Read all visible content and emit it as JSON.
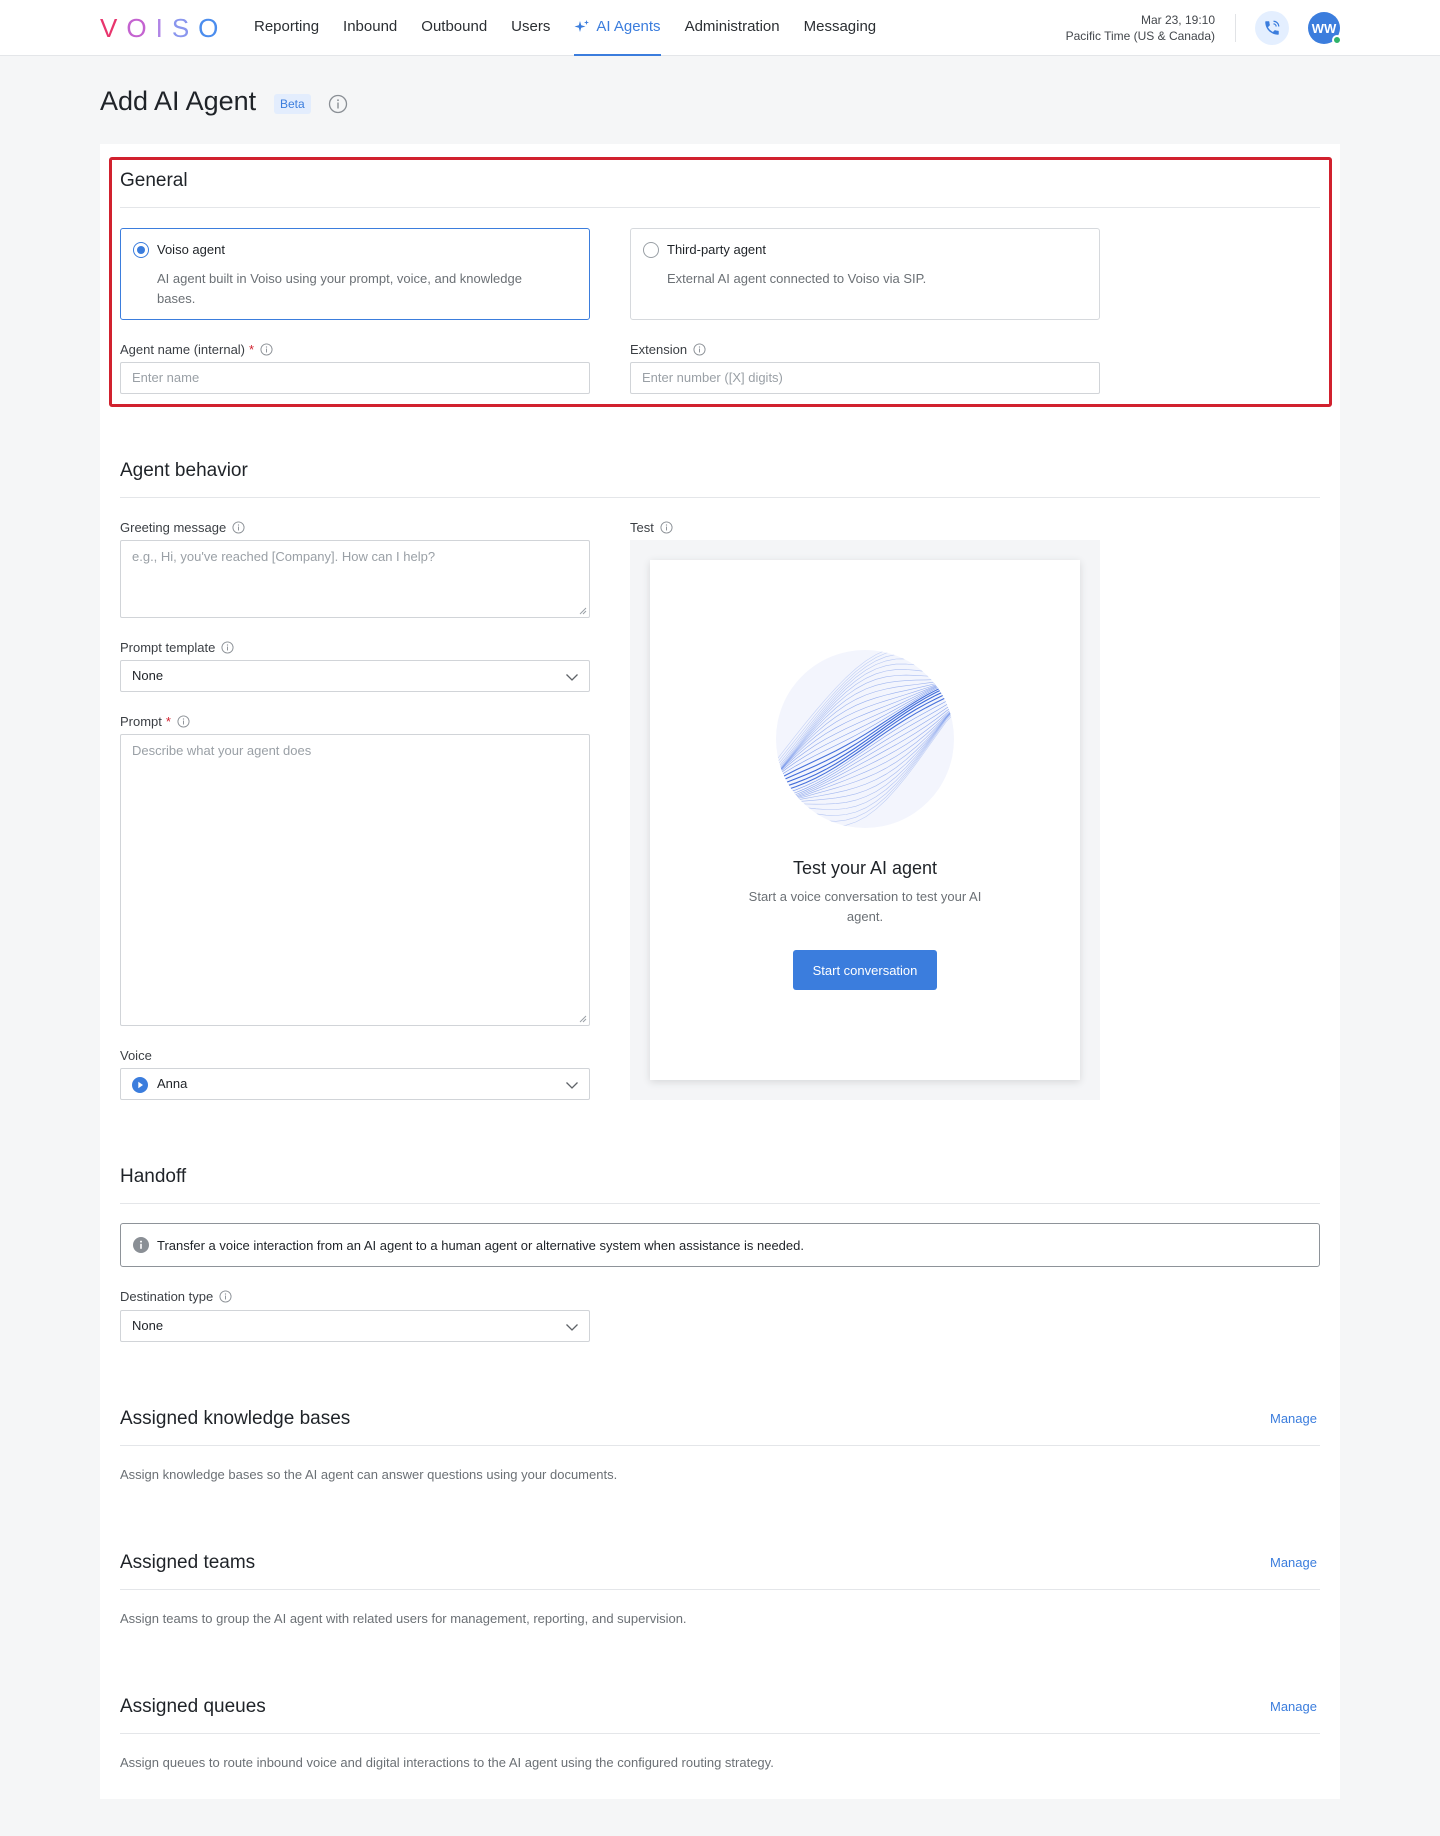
{
  "brand": {
    "logo_letters": [
      "V",
      "O",
      "I",
      "S",
      "O"
    ],
    "logo_colors": [
      "#e8356d",
      "#c463d0",
      "#b085e6",
      "#8a96ee",
      "#4b8dee"
    ]
  },
  "nav": {
    "items": [
      {
        "label": "Reporting"
      },
      {
        "label": "Inbound"
      },
      {
        "label": "Outbound"
      },
      {
        "label": "Users"
      },
      {
        "label": "AI Agents",
        "active": true,
        "icon": "sparkle-icon"
      },
      {
        "label": "Administration"
      },
      {
        "label": "Messaging"
      }
    ],
    "datetime": "Mar 23, 19:10",
    "timezone": "Pacific Time (US & Canada)",
    "avatar_initials": "WW",
    "accent": "#3b7ddd"
  },
  "page": {
    "title": "Add AI Agent",
    "badge": "Beta"
  },
  "general": {
    "title": "General",
    "options": [
      {
        "title": "Voiso agent",
        "desc": "AI agent built in Voiso using your prompt, voice, and knowledge bases.",
        "selected": true
      },
      {
        "title": "Third-party agent",
        "desc": "External AI agent connected to Voiso via SIP.",
        "selected": false
      }
    ],
    "agent_name_label": "Agent name (internal)",
    "required_mark": "*",
    "agent_name_placeholder": "Enter name",
    "extension_label": "Extension",
    "extension_placeholder": "Enter number ([X] digits)"
  },
  "behavior": {
    "title": "Agent behavior",
    "greeting_label": "Greeting message",
    "greeting_placeholder": "e.g., Hi, you've reached [Company]. How can I help?",
    "prompt_template_label": "Prompt template",
    "prompt_template_value": "None",
    "prompt_label": "Prompt",
    "prompt_placeholder": "Describe what your agent does",
    "voice_label": "Voice",
    "voice_value": "Anna",
    "test_label": "Test",
    "test_title": "Test your AI agent",
    "test_desc": "Start a voice conversation to test your AI agent.",
    "start_button": "Start conversation"
  },
  "handoff": {
    "title": "Handoff",
    "notice": "Transfer a voice interaction from an AI agent to a human agent or alternative system when assistance is needed.",
    "destination_label": "Destination type",
    "destination_value": "None"
  },
  "knowledge": {
    "title": "Assigned knowledge bases",
    "manage": "Manage",
    "desc": "Assign knowledge bases so the AI agent can answer questions using your documents."
  },
  "teams": {
    "title": "Assigned teams",
    "manage": "Manage",
    "desc": "Assign teams to group the AI agent with related users for management, reporting, and supervision."
  },
  "queues": {
    "title": "Assigned queues",
    "manage": "Manage",
    "desc": "Assign queues to route inbound voice and digital interactions to the AI agent using the configured routing strategy."
  }
}
